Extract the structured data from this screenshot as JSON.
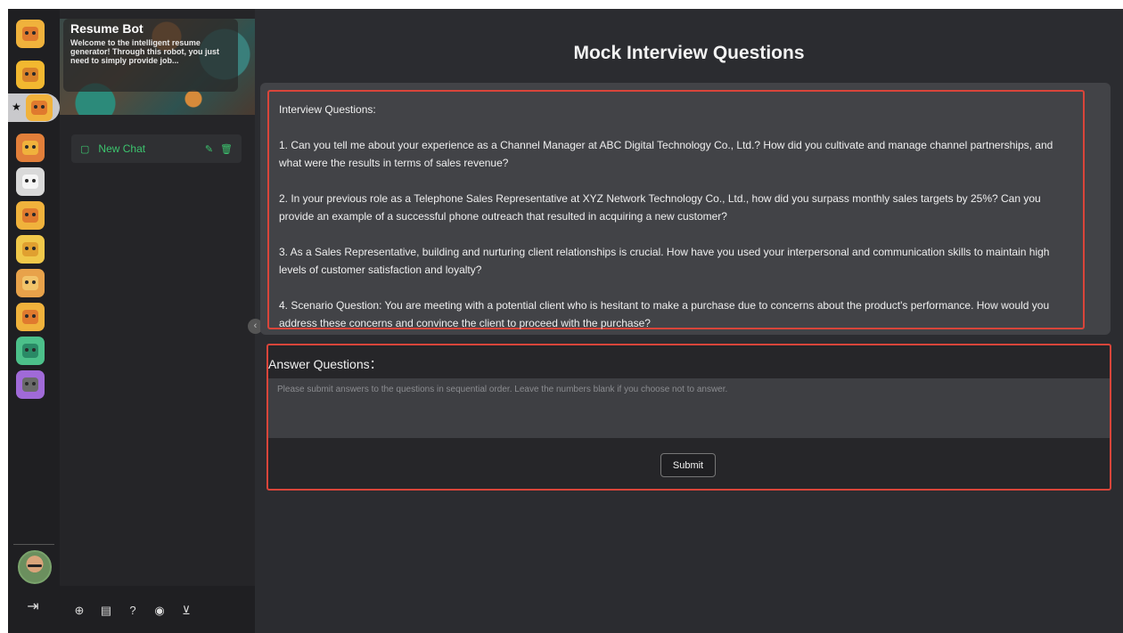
{
  "colors": {
    "accent_green": "#3cc46e",
    "highlight_red": "#d9453a",
    "background": "#2b2c30"
  },
  "rail": {
    "bots": [
      {
        "name": "orange-bot-icon",
        "color": "#f0b23c",
        "face": "#e07a2e"
      },
      {
        "name": "yellow-bot-icon",
        "color": "#f2b830",
        "face": "#d9822a"
      },
      {
        "name": "orange-bot-icon",
        "color": "#f0b23c",
        "face": "#e07a2e"
      },
      {
        "name": "orange-bot-icon",
        "color": "#e27f3a",
        "face": "#f0b23c"
      },
      {
        "name": "white-bot-icon",
        "color": "#d9d9d9",
        "face": "#f5f5f5"
      },
      {
        "name": "orange-bot-icon",
        "color": "#f0b23c",
        "face": "#e07a2e"
      },
      {
        "name": "yellow-bot-icon",
        "color": "#f0c84a",
        "face": "#e0a030"
      },
      {
        "name": "orange-bot-icon",
        "color": "#e8a24a",
        "face": "#f2c46a"
      },
      {
        "name": "orange-bot-icon",
        "color": "#f0b23c",
        "face": "#e07a2e"
      },
      {
        "name": "green-bot-icon",
        "color": "#4cc08a",
        "face": "#2a8a66"
      },
      {
        "name": "purple-bot-icon",
        "color": "#a06ad8",
        "face": "#6a6a6a"
      }
    ],
    "active_star": "★"
  },
  "banner": {
    "title": "Resume Bot",
    "text": "Welcome to the intelligent resume generator! Through this robot, you just need to simply provide job..."
  },
  "chat": {
    "label": "New Chat"
  },
  "main": {
    "title": "Mock Interview Questions",
    "questions_heading": "Interview Questions:",
    "questions": [
      "1. Can you tell me about your experience as a Channel Manager at ABC Digital Technology Co., Ltd.? How did you cultivate and manage channel partnerships, and what were the results in terms of sales revenue?",
      "2. In your previous role as a Telephone Sales Representative at XYZ Network Technology Co., Ltd., how did you surpass monthly sales targets by 25%? Can you provide an example of a successful phone outreach that resulted in acquiring a new customer?",
      "3. As a Sales Representative, building and nurturing client relationships is crucial. How have you used your interpersonal and communication skills to maintain high levels of customer satisfaction and loyalty?",
      "4. Scenario Question: You are meeting with a potential client who is hesitant to make a purchase due to concerns about the product's performance. How would you address these concerns and convince the client to proceed with the purchase?"
    ],
    "answer_label": "Answer Questions：",
    "answer_placeholder": "Please submit answers to the questions in sequential order. Leave the numbers blank if you choose not to answer.",
    "submit_label": "Submit"
  }
}
